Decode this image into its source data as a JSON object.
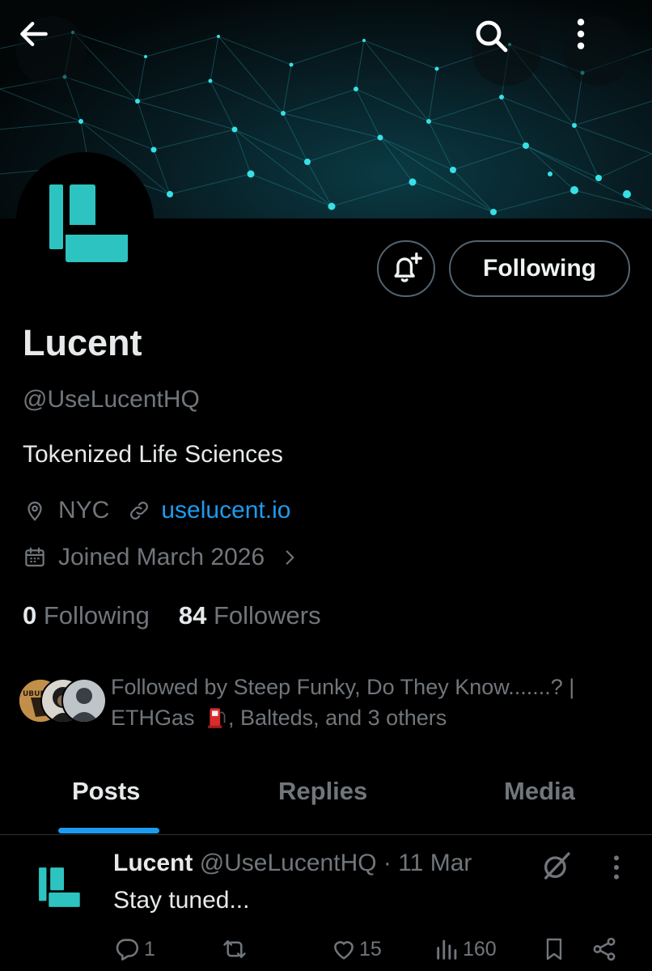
{
  "header": {
    "back_icon": "arrow-left-icon",
    "search_icon": "search-icon",
    "more_icon": "more-vertical-icon"
  },
  "profile": {
    "name": "Lucent",
    "handle": "@UseLucentHQ",
    "bio": "Tokenized Life Sciences",
    "location": "NYC",
    "website": "uselucent.io",
    "joined": "Joined March 2026",
    "following_count": "0",
    "following_label": "Following",
    "followers_count": "84",
    "followers_label": "Followers",
    "follow_button_label": "Following",
    "followed_by_line1": "Followed by Steep Funky, Do They Know.......? |",
    "followed_by_line2_a": "ETHGas",
    "followed_by_line2_b": ", Balteds, and 3 others",
    "followed_by_avatar_text": "UBUNTU"
  },
  "tabs": [
    {
      "label": "Posts",
      "active": true
    },
    {
      "label": "Replies",
      "active": false
    },
    {
      "label": "Media",
      "active": false
    }
  ],
  "post": {
    "author": "Lucent",
    "handle_time": "@UseLucentHQ · 11 Mar",
    "text": "Stay tuned...",
    "replies": "1",
    "reposts": "",
    "likes": "15",
    "views": "160"
  },
  "colors": {
    "accent": "#1d9bf0",
    "brand_teal": "#2dc3c0",
    "muted": "#71767b",
    "text": "#e7e9ea"
  }
}
